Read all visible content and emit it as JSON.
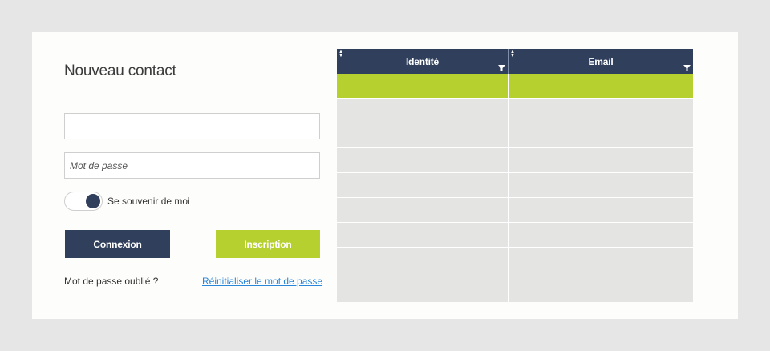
{
  "form": {
    "title": "Nouveau contact",
    "field1": {
      "value": "",
      "placeholder": ""
    },
    "password": {
      "value": "",
      "placeholder": "Mot de passe"
    },
    "remember_label": "Se souvenir de moi",
    "remember_checked": true,
    "login_label": "Connexion",
    "signup_label": "Inscription",
    "forgot_text": "Mot de passe oublié ?",
    "reset_link": "Réinitialiser le mot de passe"
  },
  "grid": {
    "columns": [
      "Identité",
      "Email"
    ],
    "rows": [
      {
        "cells": [
          "",
          ""
        ],
        "selected": true
      },
      {
        "cells": [
          "",
          ""
        ],
        "selected": false
      },
      {
        "cells": [
          "",
          ""
        ],
        "selected": false
      },
      {
        "cells": [
          "",
          ""
        ],
        "selected": false
      },
      {
        "cells": [
          "",
          ""
        ],
        "selected": false
      },
      {
        "cells": [
          "",
          ""
        ],
        "selected": false
      },
      {
        "cells": [
          "",
          ""
        ],
        "selected": false
      },
      {
        "cells": [
          "",
          ""
        ],
        "selected": false
      },
      {
        "cells": [
          "",
          ""
        ],
        "selected": false
      },
      {
        "cells": [
          "",
          ""
        ],
        "selected": false
      }
    ],
    "icons": {
      "sort": "sort-icon",
      "filter": "filter-icon"
    }
  },
  "colors": {
    "background": "#e6e6e6",
    "card": "#fdfdfb",
    "navy": "#2f3f5c",
    "lime": "#b5d02f",
    "link": "#2a86d8",
    "grid_cell": "#e4e4e2"
  }
}
